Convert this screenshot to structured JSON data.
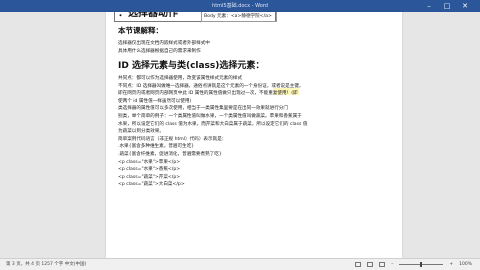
{
  "window": {
    "title": "html5基础.docx - Word",
    "minimize_icon": "minimize-icon",
    "maximize_icon": "maximize-icon",
    "close_icon": "close-icon",
    "accent": "#2b579a"
  },
  "document": {
    "section_heading": "：选择器动作",
    "code_sample": "Body 元素：<a>静德学院</a>",
    "summary_heading": "本节课解释：",
    "summary_lines": [
      "选择器仅出现在文档内嵌样式或者外部样式中",
      "具体用什么选择器根据自己的需求来制作"
    ],
    "main_heading": "ID 选择元素与类(class)选择元素：",
    "body_lines": [
      "共同点：都可以作为选择器使用，改变该属性样式元素的样式",
      "不同点：ID 选择器叫做唯一选择器，通俗点讲就是这个元素的一个身份证，或者说是主键，",
      "即在网页内或者网页内部网页中此 ID 属性的属性值做只出现过一次，不能重复使用！(即",
      "使两个 id 属性值一样虽然可以使用)",
      "类选择器的属性值可以多次使用，相当于一类属性集里要是在出同一效果就进行分门",
      "别类，举个简单的例子：一个类属性值叫做水果，一个类属性值叫做蔬菜。苹果和香蕉属于",
      "水果，所以设定它们的 class 值为水果，而芹菜和大白菜属于蔬菜，所以设定它们的 class 值",
      "为蔬菜以到分类效果。",
      "简单案例代码语言（非正规 html）代码）表示就是：",
      ".水果{富含多种维生素，普遍可生吃}",
      ".蔬菜{富含纤维素，促进消化，普遍需要煮熟了吃}",
      "<p class=\"水果\">苹果</p>",
      "<p class=\"水果\">香蕉</p>",
      "<p class=\"蔬菜\">芹菜</p>",
      "<p class=\"蔬菜\">大白菜</p>"
    ]
  },
  "statusbar": {
    "left_text": "第 3 页，共 4 页   1257 个字   中文(中国)",
    "zoom_label": "100%",
    "zoom_level": 0.5
  }
}
